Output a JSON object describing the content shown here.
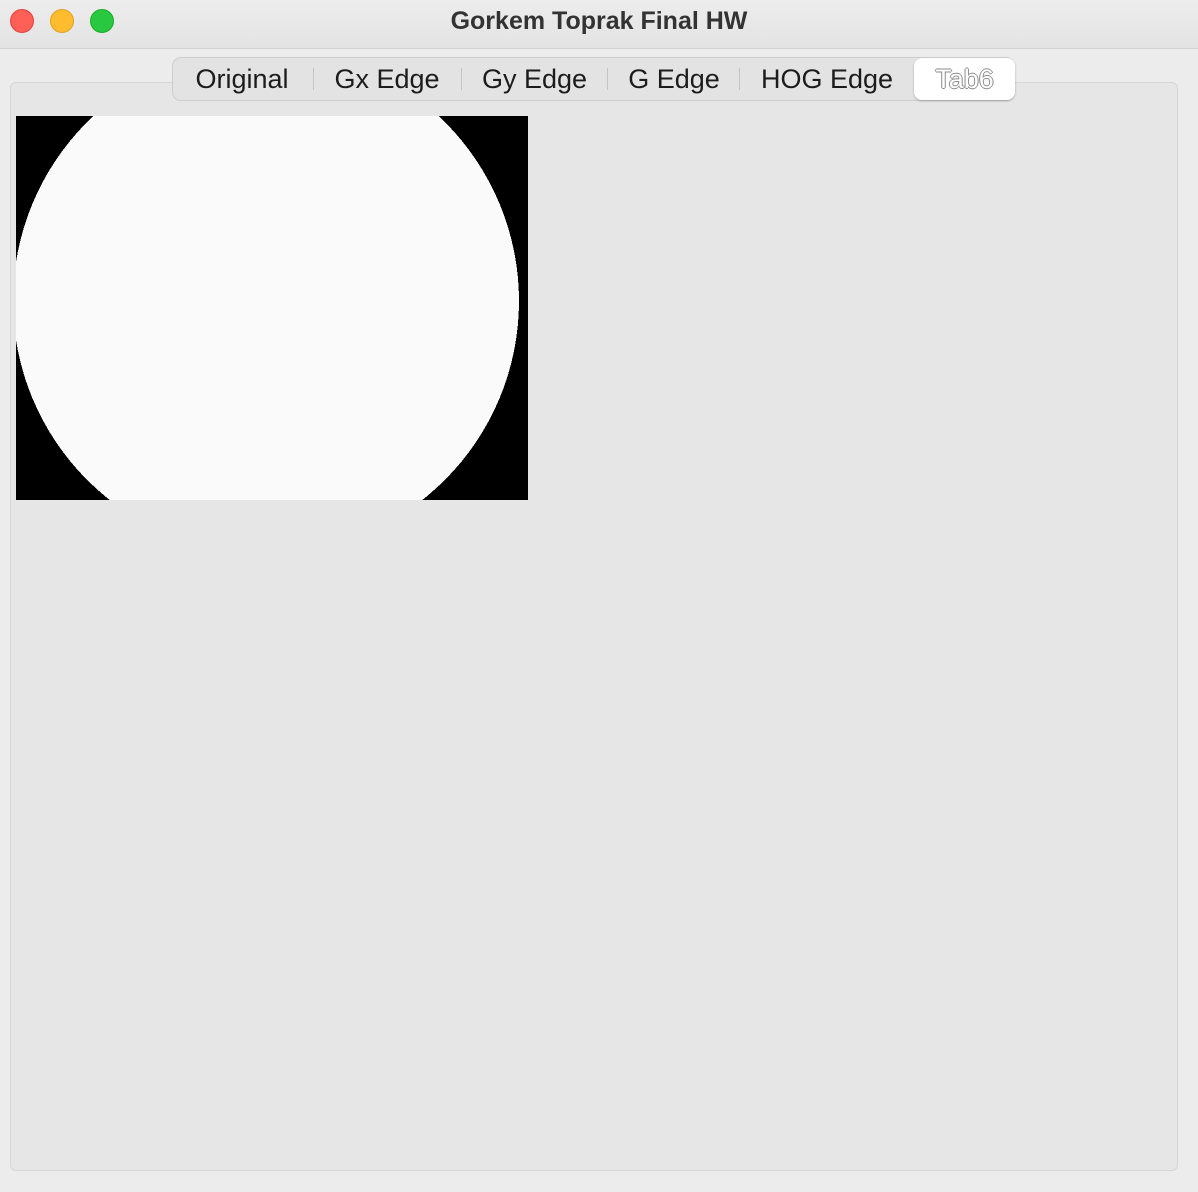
{
  "window": {
    "title": "Gorkem Toprak Final HW"
  },
  "window_controls": {
    "close": "close-button",
    "minimize": "minimize-button",
    "zoom": "zoom-button"
  },
  "tabs": [
    {
      "label": "Original",
      "selected": false
    },
    {
      "label": "Gx Edge",
      "selected": false
    },
    {
      "label": "Gy Edge",
      "selected": false
    },
    {
      "label": "G Edge",
      "selected": false
    },
    {
      "label": "HOG Edge",
      "selected": false
    },
    {
      "label": "Tab6",
      "selected": true
    }
  ],
  "image": {
    "description_colors": {
      "background": "#000000",
      "shape": "#fafafa"
    }
  }
}
